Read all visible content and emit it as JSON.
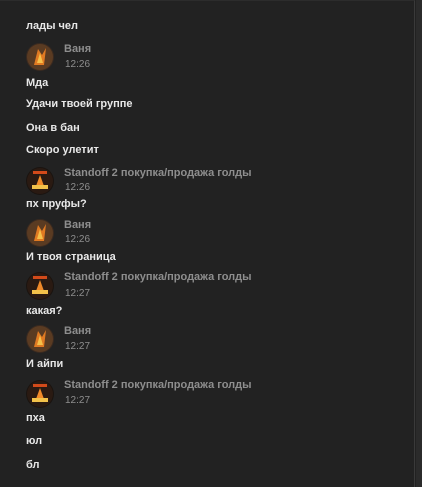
{
  "colors": {
    "background": "#222222",
    "message_text": "#e8e8e8",
    "meta_text": "#8e8e8e"
  },
  "messages": [
    {
      "text": "лады чел"
    },
    {
      "author": "Ваня",
      "time": "12:26",
      "avatar": "avatar-vanya"
    },
    {
      "text": "Мда"
    },
    {
      "text": "Удачи твоей группе"
    },
    {
      "text": "Она в бан"
    },
    {
      "text": "Скоро улетит"
    },
    {
      "author": "Standoff 2 покупка/продажа голды",
      "time": "12:26",
      "avatar": "avatar-standoff-group"
    },
    {
      "text": "пх пруфы?"
    },
    {
      "author": "Ваня",
      "time": "12:26",
      "avatar": "avatar-vanya"
    },
    {
      "text": "И твоя страница"
    },
    {
      "author": "Standoff 2 покупка/продажа голды",
      "time": "12:27",
      "avatar": "avatar-standoff-group"
    },
    {
      "text": "какая?"
    },
    {
      "author": "Ваня",
      "time": "12:27",
      "avatar": "avatar-vanya"
    },
    {
      "text": "И айпи"
    },
    {
      "author": "Standoff 2 покупка/продажа голды",
      "time": "12:27",
      "avatar": "avatar-standoff-group"
    },
    {
      "text": "пха"
    },
    {
      "text": "юл"
    },
    {
      "text": "бл"
    }
  ]
}
